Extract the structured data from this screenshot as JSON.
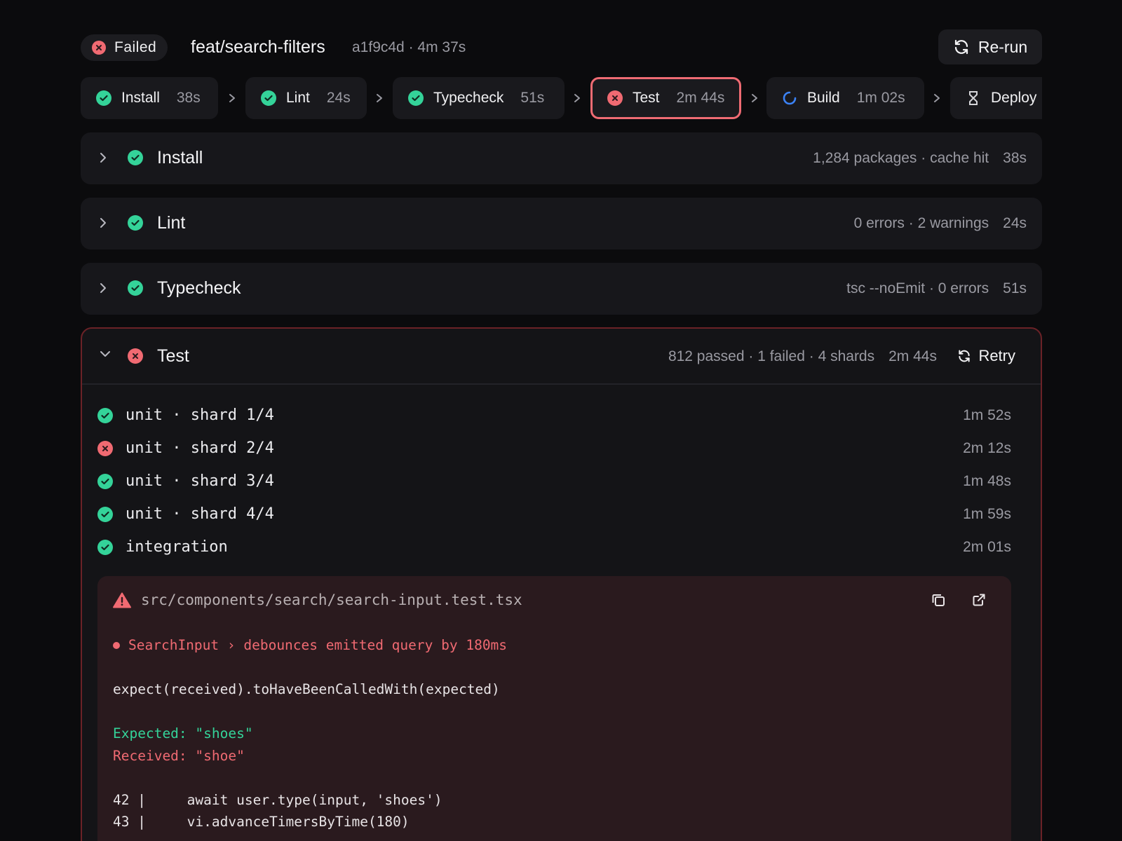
{
  "header": {
    "status": "Failed",
    "branch": "feat/search-filters",
    "commit_meta": "a1f9c4d · 4m 37s",
    "rerun_label": "Re-run"
  },
  "pipeline": [
    {
      "label": "Install",
      "duration": "38s",
      "status": "success"
    },
    {
      "label": "Lint",
      "duration": "24s",
      "status": "success"
    },
    {
      "label": "Typecheck",
      "duration": "51s",
      "status": "success"
    },
    {
      "label": "Test",
      "duration": "2m 44s",
      "status": "failed"
    },
    {
      "label": "Build",
      "duration": "1m 02s",
      "status": "running"
    },
    {
      "label": "Deploy",
      "duration": "",
      "status": "pending"
    }
  ],
  "jobs": [
    {
      "title": "Install",
      "detail": "1,284 packages · cache hit",
      "duration": "38s",
      "status": "success"
    },
    {
      "title": "Lint",
      "detail": "0 errors · 2 warnings",
      "duration": "24s",
      "status": "success"
    },
    {
      "title": "Typecheck",
      "detail": "tsc --noEmit · 0 errors",
      "duration": "51s",
      "status": "success"
    }
  ],
  "test_panel": {
    "title": "Test",
    "summary": "812 passed · 1 failed · 4 shards",
    "duration": "2m 44s",
    "retry_label": "Retry",
    "shards": [
      {
        "name": "unit · shard 1/4",
        "duration": "1m 52s",
        "status": "success"
      },
      {
        "name": "unit · shard 2/4",
        "duration": "2m 12s",
        "status": "failed"
      },
      {
        "name": "unit · shard 3/4",
        "duration": "1m 48s",
        "status": "success"
      },
      {
        "name": "unit · shard 4/4",
        "duration": "1m 59s",
        "status": "success"
      },
      {
        "name": "integration",
        "duration": "2m 01s",
        "status": "success"
      }
    ],
    "error": {
      "file": "src/components/search/search-input.test.tsx",
      "test_name": "SearchInput › debounces emitted query by 180ms",
      "assertion": "expect(received).toHaveBeenCalledWith(expected)",
      "expected": "Expected: \"shoes\"",
      "received": "Received: \"shoe\"",
      "lines": [
        {
          "text": "42 |     await user.type(input, 'shoes')"
        },
        {
          "text": "43 |     vi.advanceTimersByTime(180)"
        }
      ]
    }
  },
  "colors": {
    "success": "#34d399",
    "failed": "#f06a72",
    "running": "#3b82f6",
    "background": "#0b0b0d",
    "surface": "#17171b"
  },
  "icons": {
    "success": "check-circle-icon",
    "failed": "x-circle-icon",
    "running": "spinner-icon",
    "pending": "hourglass-icon",
    "rerun": "refresh-icon",
    "warning": "warning-triangle-icon",
    "copy": "copy-icon",
    "open": "external-link-icon"
  }
}
